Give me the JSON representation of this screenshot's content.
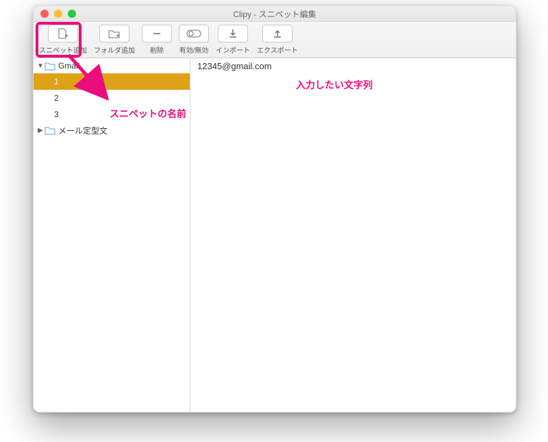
{
  "window": {
    "title": "Clipy - スニペット編集"
  },
  "toolbar": {
    "add_snippet": "スニペット追加",
    "add_folder": "フォルダ追加",
    "delete": "削除",
    "enable": "有効/無効",
    "import": "インポート",
    "export": "エクスポート"
  },
  "sidebar": {
    "folders": [
      {
        "name": "Gmail",
        "expanded": true,
        "snippets": [
          {
            "name": "1",
            "selected": true
          },
          {
            "name": "2",
            "selected": false
          },
          {
            "name": "3",
            "selected": false
          }
        ]
      },
      {
        "name": "メール定型文",
        "expanded": false,
        "snippets": []
      }
    ]
  },
  "content": {
    "value": "12345@gmail.com"
  },
  "annotations": {
    "snippet_name_label": "スニペットの名前",
    "content_label": "入力したい文字列"
  },
  "colors": {
    "selection": "#dfa216",
    "annotation": "#ec0c7c",
    "folder_icon": "#7fb0e6"
  }
}
